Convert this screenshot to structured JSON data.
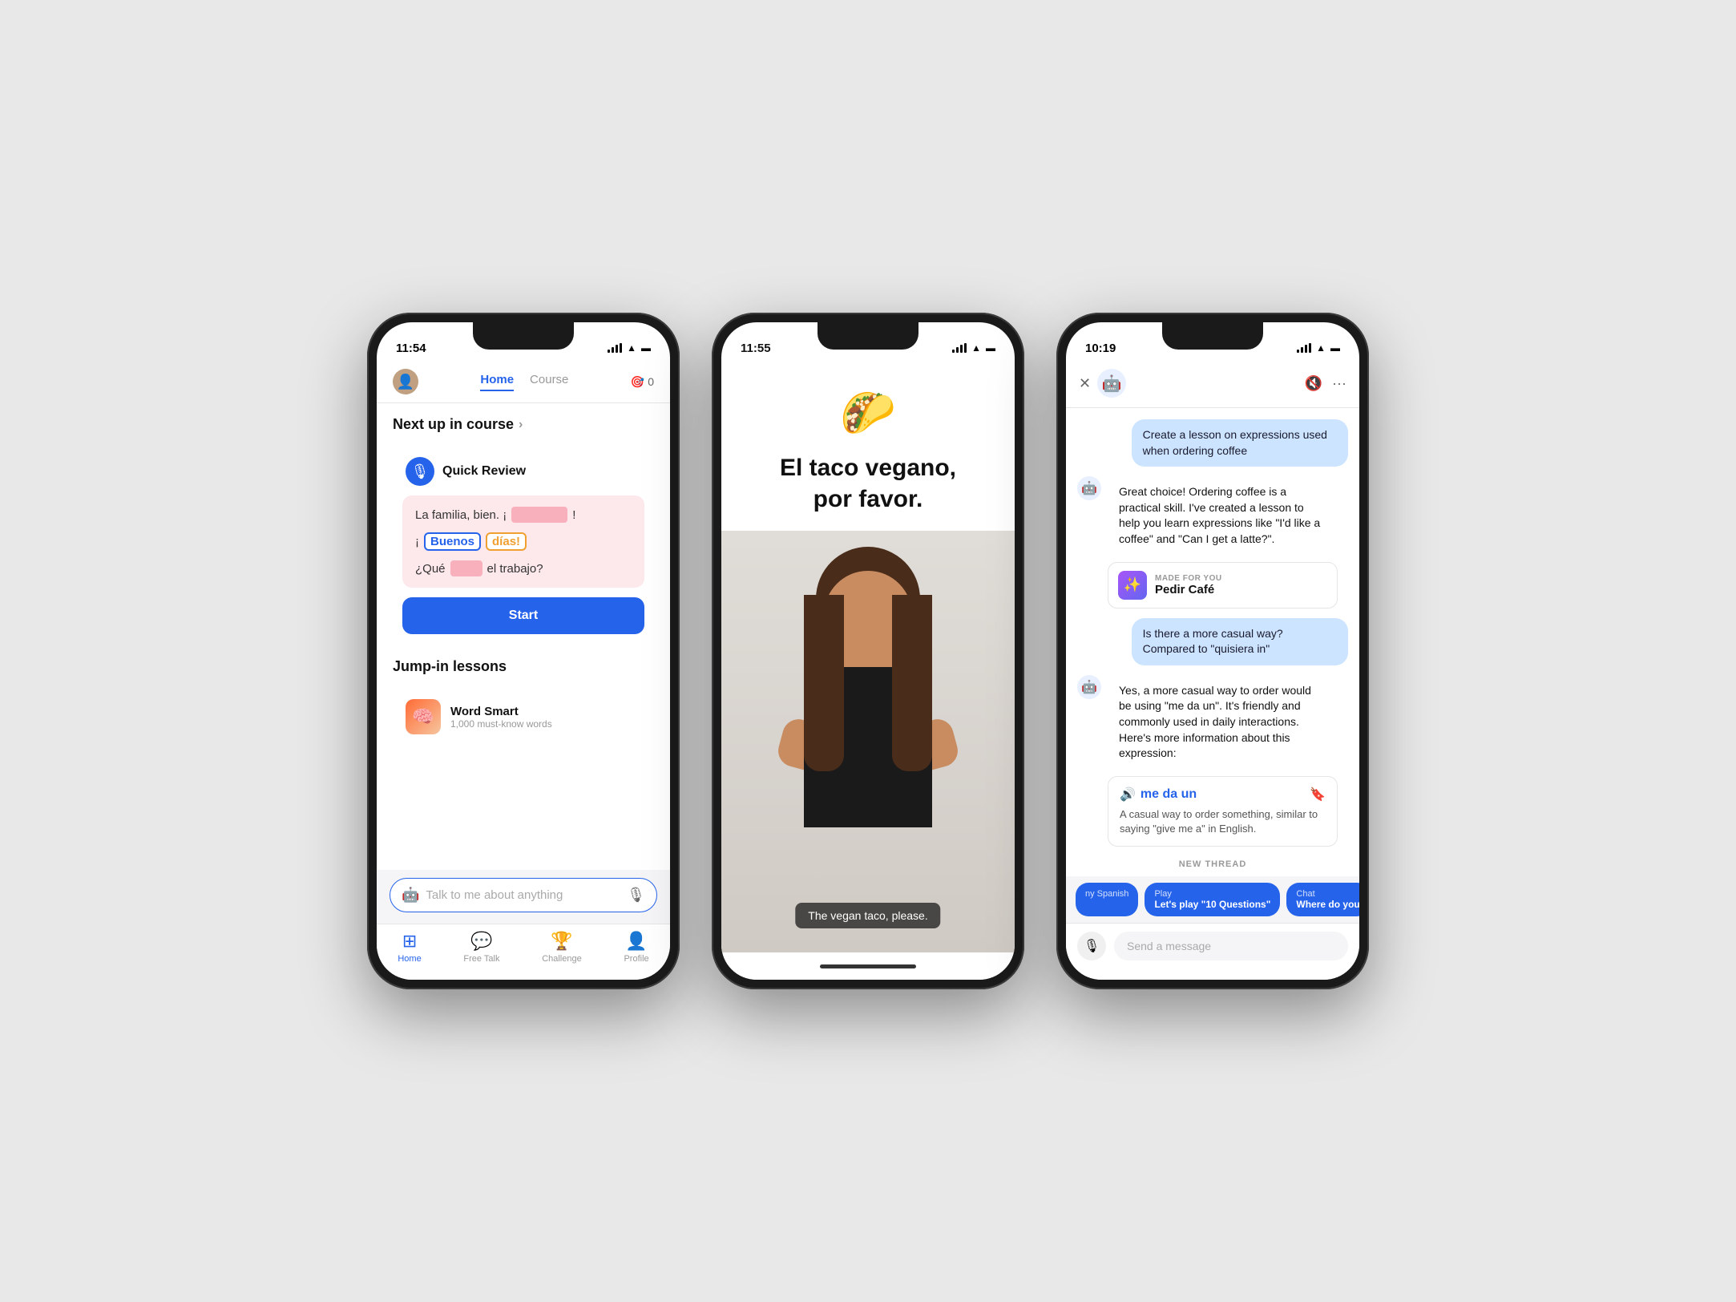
{
  "phone1": {
    "status_time": "11:54",
    "nav": {
      "avatar_emoji": "👤",
      "tabs": [
        "Home",
        "Course"
      ],
      "active_tab": "Home",
      "streak_label": "🎯 0"
    },
    "section1_title": "Next up in course",
    "quick_review": {
      "title": "Quick Review",
      "line1": "La familia, bien. ¡",
      "line2_word1": "Buenos",
      "line2_word2": "días!",
      "line3_prefix": "¿Qué",
      "line3_suffix": "el trabajo?",
      "start_btn": "Start"
    },
    "section2_title": "Jump-in lessons",
    "lesson": {
      "name": "Word Smart",
      "subtitle": "1,000 must-know words"
    },
    "chat_placeholder": "Talk to me about anything",
    "bottom_nav": [
      {
        "icon": "⊞",
        "label": "Home",
        "active": true
      },
      {
        "icon": "💬",
        "label": "Free Talk",
        "active": false
      },
      {
        "icon": "🏆",
        "label": "Challenge",
        "active": false
      },
      {
        "icon": "👤",
        "label": "Profile",
        "active": false
      }
    ]
  },
  "phone2": {
    "status_time": "11:55",
    "taco_emoji": "🌮",
    "title_line1": "El taco vegano,",
    "title_line2": "por favor.",
    "subtitle": "The vegan taco, please."
  },
  "phone3": {
    "status_time": "10:19",
    "msg_user1": "Create a lesson on expressions used when ordering coffee",
    "msg_bot1": "Great choice! Ordering coffee is a practical skill. I've created a lesson to help you learn expressions like \"I'd like a coffee\" and \"Can I get a latte?\".",
    "lesson_made_for_you": "MADE FOR YOU",
    "lesson_name": "Pedir Café",
    "msg_user2": "Is there a more casual way? Compared to \"quisiera in\"",
    "msg_bot2": "Yes, a more casual way to order would be using \"me da un\". It's friendly and commonly used in daily interactions. Here's more information about this expression:",
    "expression_word": "me da un",
    "expression_def": "A casual way to order something, similar to saying \"give me a\" in English.",
    "new_thread": "NEW THREAD",
    "chips": [
      {
        "title": "ny Spanish",
        "body": ""
      },
      {
        "title": "Play",
        "body": "Let's play \"10 Questions\""
      },
      {
        "title": "Chat",
        "body": "Where do you"
      }
    ],
    "input_placeholder": "Send a message",
    "close_icon": "✕",
    "mute_icon": "🔇",
    "more_icon": "···",
    "robot_emoji": "🤖",
    "bookmark_icon": "🔖",
    "sound_icon": "🔊"
  }
}
